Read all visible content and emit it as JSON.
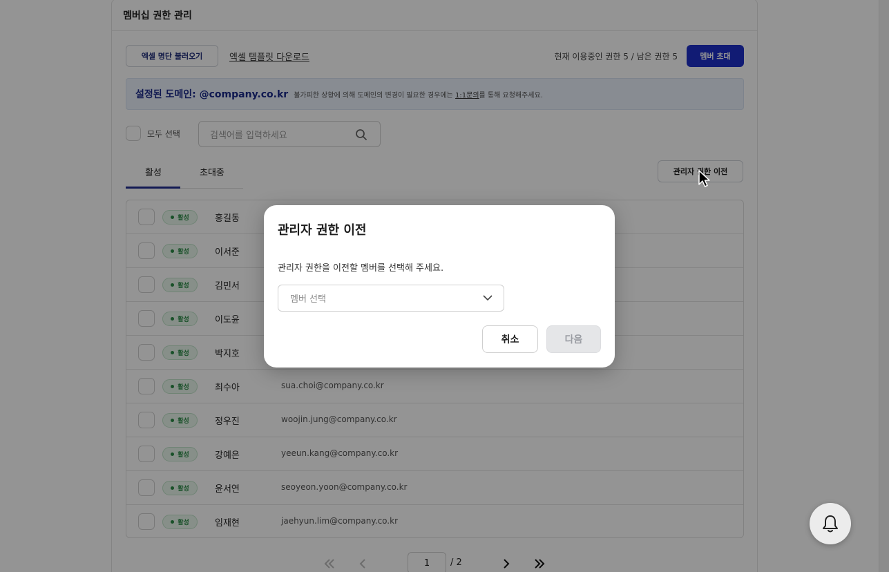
{
  "page": {
    "title": "멤버십 권한 관리"
  },
  "toolbar": {
    "import_excel": "엑셀 명단 불러오기",
    "download_template": "엑셀 템플릿 다운로드",
    "usage": "현재 이용중인 권한 5 / 남은 권한 5",
    "invite": "멤버 초대"
  },
  "domain": {
    "label": "설정된 도메인: @company.co.kr",
    "note_before": "불가피한 상황에 의해 도메인의 변경이 필요한 경우에는 ",
    "note_link": "1:1문의",
    "note_after": "를 통해 요청해주세요."
  },
  "filter": {
    "select_all": "모두 선택",
    "search_placeholder": "검색어를 입력하세요"
  },
  "tabs": [
    {
      "label": "활성",
      "active": true
    },
    {
      "label": "초대중",
      "active": false
    }
  ],
  "transfer_admin_button": "관리자 권한 이전",
  "status_badge": "활성",
  "members": [
    {
      "name": "홍길동",
      "email": ""
    },
    {
      "name": "이서준",
      "email": ""
    },
    {
      "name": "김민서",
      "email": ""
    },
    {
      "name": "이도윤",
      "email": ""
    },
    {
      "name": "박지호",
      "email": ""
    },
    {
      "name": "최수아",
      "email": "sua.choi@company.co.kr"
    },
    {
      "name": "정우진",
      "email": "woojin.jung@company.co.kr"
    },
    {
      "name": "강예은",
      "email": "yeeun.kang@company.co.kr"
    },
    {
      "name": "윤서연",
      "email": "seoyeon.yoon@company.co.kr"
    },
    {
      "name": "임재현",
      "email": "jaehyun.lim@company.co.kr"
    }
  ],
  "pagination": {
    "current": "1",
    "total": "/ 2"
  },
  "modal": {
    "title": "관리자 권한 이전",
    "description": "관리자 권한을 이전할 멤버를 선택해 주세요.",
    "select_placeholder": "멤버 선택",
    "cancel": "취소",
    "next": "다음"
  },
  "colors": {
    "primary": "#1e30c8",
    "active_badge": "#2a8a45",
    "tab_indicator": "#1f2b8f",
    "overlay": "rgba(0,0,0,0.42)"
  },
  "icons": {
    "search": "search-icon",
    "bell": "bell-icon",
    "chevron": "chevron-down-icon",
    "first_page": "double-chevron-left-icon",
    "prev_page": "chevron-left-icon",
    "next_page": "chevron-right-icon",
    "last_page": "double-chevron-right-icon"
  }
}
